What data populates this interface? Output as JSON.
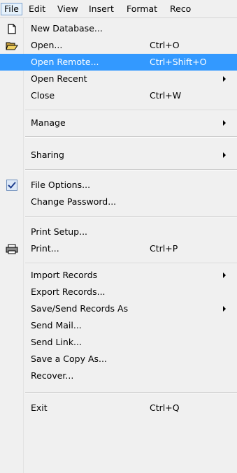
{
  "menubar": {
    "items": [
      {
        "label": "File",
        "active": true
      },
      {
        "label": "Edit"
      },
      {
        "label": "View"
      },
      {
        "label": "Insert"
      },
      {
        "label": "Format"
      },
      {
        "label": "Reco"
      }
    ]
  },
  "menu": {
    "items": [
      {
        "label": "New Database...",
        "icon": "new-document-icon"
      },
      {
        "label": "Open...",
        "shortcut": "Ctrl+O",
        "icon": "open-folder-icon"
      },
      {
        "label": "Open Remote...",
        "shortcut": "Ctrl+Shift+O",
        "highlighted": true
      },
      {
        "label": "Open Recent",
        "submenu": true
      },
      {
        "label": "Close",
        "shortcut": "Ctrl+W"
      },
      {
        "label": "Manage",
        "submenu": true
      },
      {
        "label": "Sharing",
        "submenu": true
      },
      {
        "label": "File Options...",
        "icon": "checkmark-icon"
      },
      {
        "label": "Change Password..."
      },
      {
        "label": "Print Setup..."
      },
      {
        "label": "Print...",
        "shortcut": "Ctrl+P",
        "icon": "printer-icon"
      },
      {
        "label": "Import Records",
        "submenu": true
      },
      {
        "label": "Export Records..."
      },
      {
        "label": "Save/Send Records As",
        "submenu": true
      },
      {
        "label": "Send Mail..."
      },
      {
        "label": "Send Link..."
      },
      {
        "label": "Save a Copy As..."
      },
      {
        "label": "Recover..."
      },
      {
        "label": "Exit",
        "shortcut": "Ctrl+Q"
      }
    ]
  },
  "colors": {
    "highlight": "#3399ff",
    "menu_background": "#f0f0f0",
    "active_menubar_border": "#7da2ce"
  }
}
